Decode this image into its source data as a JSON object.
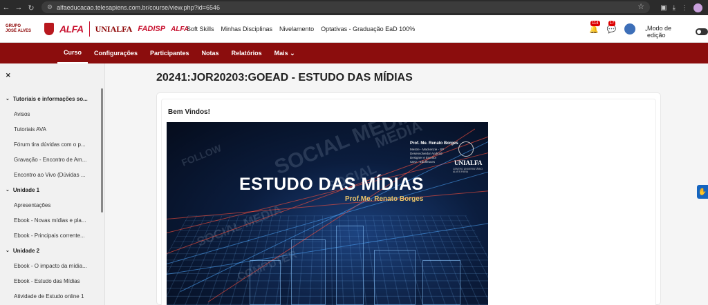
{
  "browser": {
    "url": "alfaeducacao.telesapiens.com.br/course/view.php?id=6546",
    "icons": [
      "back-icon",
      "forward-icon",
      "reload-icon",
      "site-info-icon",
      "star-icon",
      "extensions-icon",
      "download-icon",
      "menu-icon",
      "profile-avatar"
    ]
  },
  "header": {
    "logos": {
      "jose_line1": "GRUPO",
      "jose_line2": "JOSÉ ALVES",
      "alfa": "ALFA",
      "unialfa": "UNIALFA",
      "fadisp": "FADISP",
      "alfa2": "ALFA"
    },
    "menu": [
      "Soft Skills",
      "Minhas Disciplinas",
      "Nivelamento",
      "Optativas - Graduação EaD 100%"
    ],
    "notifications_count": "114",
    "messages_count": "17",
    "edit_mode_label": "Modo de edição"
  },
  "secondary_nav": [
    {
      "label": "Curso",
      "active": true
    },
    {
      "label": "Configurações",
      "active": false
    },
    {
      "label": "Participantes",
      "active": false
    },
    {
      "label": "Notas",
      "active": false
    },
    {
      "label": "Relatórios",
      "active": false
    },
    {
      "label": "Mais ⌄",
      "active": false
    }
  ],
  "drawer": {
    "close_glyph": "✕",
    "rows": [
      {
        "type": "section",
        "label": "Tutoriais e informações so..."
      },
      {
        "type": "item",
        "label": "Avisos"
      },
      {
        "type": "item",
        "label": "Tutoriais AVA"
      },
      {
        "type": "item",
        "label": "Fórum tira dúvidas com o p..."
      },
      {
        "type": "item",
        "label": "Gravação - Encontro de Am..."
      },
      {
        "type": "item",
        "label": "Encontro ao Vivo (Dúvidas ..."
      },
      {
        "type": "section",
        "label": "Unidade 1"
      },
      {
        "type": "item",
        "label": "Apresentações"
      },
      {
        "type": "item",
        "label": "Ebook - Novas mídias e pla..."
      },
      {
        "type": "item",
        "label": "Ebook - Principais corrente..."
      },
      {
        "type": "section",
        "label": "Unidade 2"
      },
      {
        "type": "item",
        "label": "Ebook - O impacto da mídia..."
      },
      {
        "type": "item",
        "label": "Ebook - Estudo das Mídias"
      },
      {
        "type": "item",
        "label": "Atividade de Estudo online 1"
      }
    ]
  },
  "main": {
    "course_title": "20241:JOR20203:GOEAD - ESTUDO DAS MÍDIAS",
    "welcome": "Bem Vindos!",
    "banner": {
      "title": "ESTUDO DAS MÍDIAS",
      "subtitle": "Prof.Me. Renato Borges",
      "prof_name": "Prof. Me. Renato Borges",
      "prof_lines": [
        "Mestre - Mackenzie - SP",
        "Desenvolvedor Android",
        "Designer e Escritor",
        "CEO - Edufleuces"
      ],
      "unialfa": "UNIALFA",
      "unialfa_sub": "CENTRO UNIVERSITÁRIO ALVES FARIA",
      "watermarks": [
        "SOCIAL MEDIA",
        "SOCIAL MEDIA",
        "SOCIAL",
        "MEDIA",
        "FOLLOW",
        "COMPUTER"
      ]
    }
  }
}
